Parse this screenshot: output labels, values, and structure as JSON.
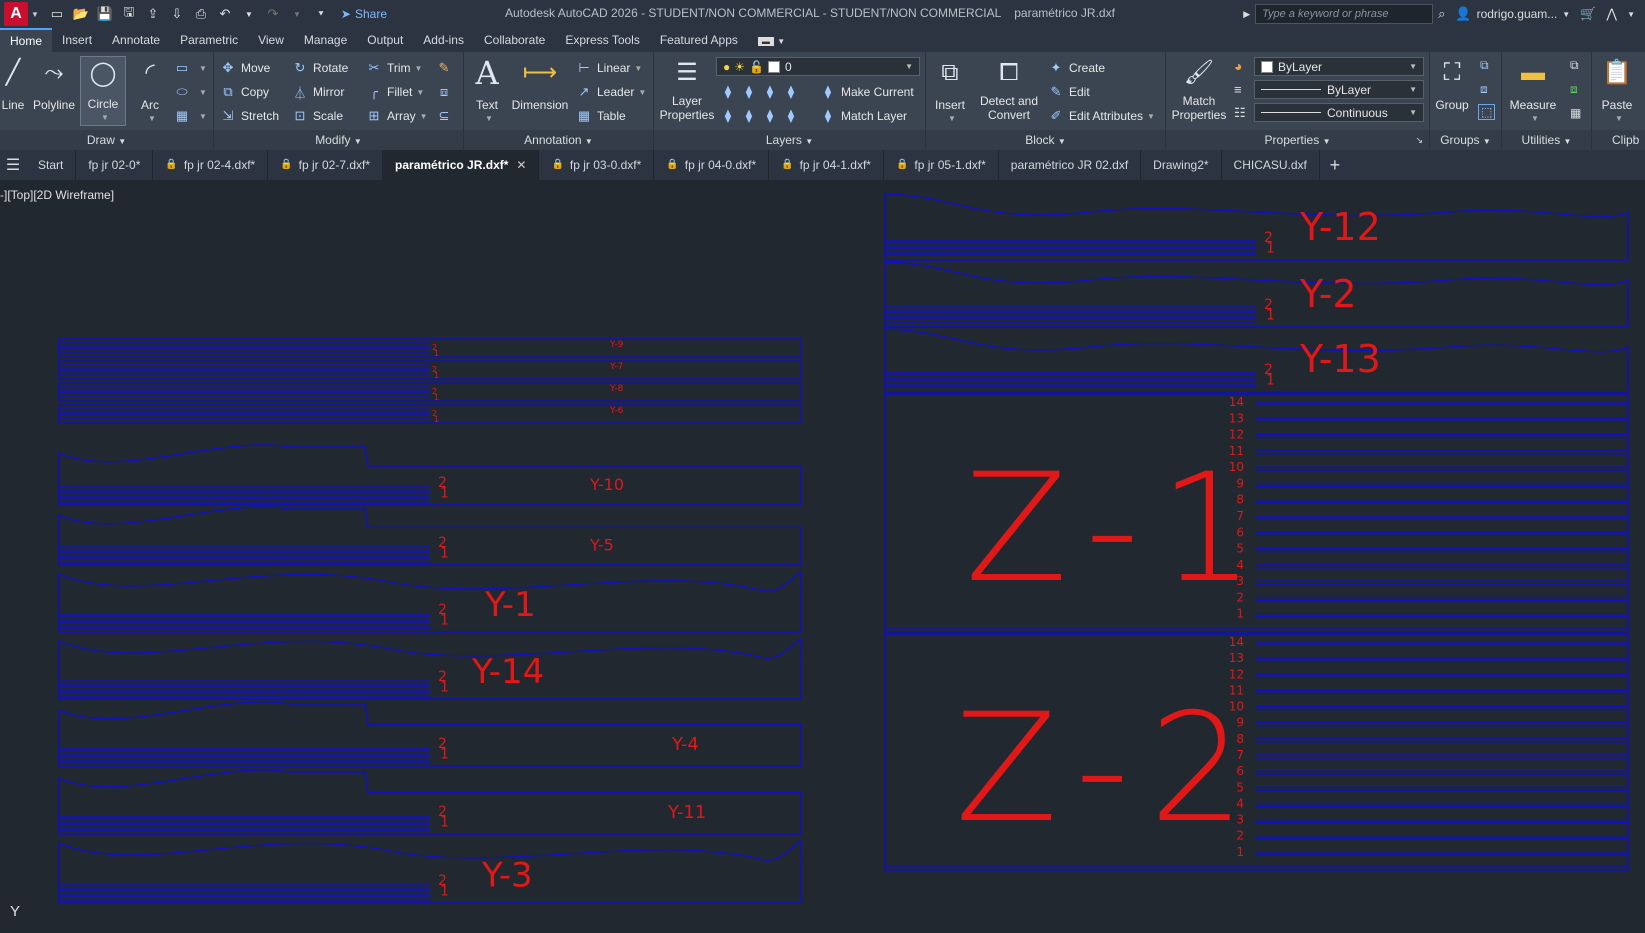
{
  "app": {
    "logo_letter": "A",
    "title": "Autodesk AutoCAD 2026 - STUDENT/NON COMMERCIAL - STUDENT/NON COMMERCIAL",
    "file_title": "paramétrico JR.dxf",
    "share_label": "Share",
    "search_placeholder": "Type a keyword or phrase",
    "user_name": "rodrigo.guam..."
  },
  "ribbon_tabs": [
    "Home",
    "Insert",
    "Annotate",
    "Parametric",
    "View",
    "Manage",
    "Output",
    "Add-ins",
    "Collaborate",
    "Express Tools",
    "Featured Apps"
  ],
  "panels": {
    "draw": {
      "title": "Draw",
      "line": "Line",
      "polyline": "Polyline",
      "circle": "Circle",
      "arc": "Arc"
    },
    "modify": {
      "title": "Modify",
      "move": "Move",
      "rotate": "Rotate",
      "trim": "Trim",
      "copy": "Copy",
      "mirror": "Mirror",
      "fillet": "Fillet",
      "stretch": "Stretch",
      "scale": "Scale",
      "array": "Array"
    },
    "annotation": {
      "title": "Annotation",
      "text": "Text",
      "dimension": "Dimension",
      "linear": "Linear",
      "leader": "Leader",
      "table": "Table"
    },
    "layers": {
      "title": "Layers",
      "layer_properties_1": "Layer",
      "layer_properties_2": "Properties",
      "current_layer": "0",
      "make_current": "Make Current",
      "match_layer": "Match Layer"
    },
    "block": {
      "title": "Block",
      "insert": "Insert",
      "detect_1": "Detect and",
      "detect_2": "Convert",
      "create": "Create",
      "edit": "Edit",
      "edit_attributes": "Edit Attributes"
    },
    "properties": {
      "title": "Properties",
      "match_1": "Match",
      "match_2": "Properties",
      "color": "ByLayer",
      "lineweight": "ByLayer",
      "linetype": "Continuous"
    },
    "groups": {
      "title": "Groups",
      "group": "Group"
    },
    "utilities": {
      "title": "Utilities",
      "measure": "Measure"
    },
    "clipboard": {
      "title": "Clipb",
      "paste": "Paste"
    }
  },
  "file_tabs": [
    {
      "label": "Start",
      "locked": false,
      "active": false
    },
    {
      "label": "fp jr 02-0*",
      "locked": false,
      "active": false
    },
    {
      "label": "fp jr 02-4.dxf*",
      "locked": true,
      "active": false
    },
    {
      "label": "fp jr 02-7.dxf*",
      "locked": true,
      "active": false
    },
    {
      "label": "paramétrico JR.dxf*",
      "locked": false,
      "active": true
    },
    {
      "label": "fp jr 03-0.dxf*",
      "locked": true,
      "active": false
    },
    {
      "label": "fp jr 04-0.dxf*",
      "locked": true,
      "active": false
    },
    {
      "label": "fp jr 04-1.dxf*",
      "locked": true,
      "active": false
    },
    {
      "label": "fp jr 05-1.dxf*",
      "locked": true,
      "active": false
    },
    {
      "label": "paramétrico JR 02.dxf",
      "locked": false,
      "active": false
    },
    {
      "label": "Drawing2*",
      "locked": false,
      "active": false
    },
    {
      "label": "CHICASU.dxf",
      "locked": false,
      "active": false
    }
  ],
  "viewport_label": "-][Top][2D Wireframe]",
  "ucs_axis": "Y",
  "drawing": {
    "line_color": "#1010c8",
    "text_color": "#e01818",
    "small_parts": [
      "Y-9",
      "Y-7",
      "Y-8",
      "Y-6"
    ],
    "left_parts": [
      "Y-10",
      "Y-5",
      "Y-1",
      "Y-14",
      "Y-4",
      "Y-11",
      "Y-3"
    ],
    "right_parts": [
      "Y-12",
      "Y-2",
      "Y-13"
    ],
    "z_parts": [
      "Z-1",
      "Z-2"
    ],
    "z_numbers": [
      "14",
      "13",
      "12",
      "11",
      "10",
      "9",
      "8",
      "7",
      "6",
      "5",
      "4",
      "3",
      "2",
      "1"
    ],
    "part_marks": [
      "2",
      "1"
    ]
  }
}
